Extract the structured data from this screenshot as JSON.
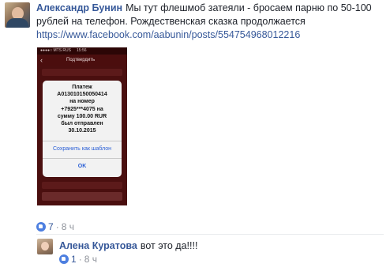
{
  "comment": {
    "author": "Александр Бунин",
    "text": "Мы тут флешмоб затеяли - бросаем парню по 50-100 рублей на телефон. Рождественская сказка продолжается",
    "link": "https://www.facebook.com/aabunin/posts/554754968012216",
    "likes": "7",
    "time": "8 ч"
  },
  "attachment": {
    "status_left": "●●●●○ MTS RUS",
    "status_time": "15:56",
    "nav_title": "Подтвердить",
    "dialog_lines": [
      "Платеж",
      "А013010150050414",
      "на номер",
      "+7925***4075 на",
      "сумму 100.00 RUR",
      "был отправлен",
      "30.10.2015"
    ],
    "save_template_label": "Сохранить как шаблон",
    "ok_label": "OK"
  },
  "reply": {
    "author": "Алена Куратова",
    "text": "вот это да!!!!",
    "likes": "1",
    "time": "8 ч"
  }
}
